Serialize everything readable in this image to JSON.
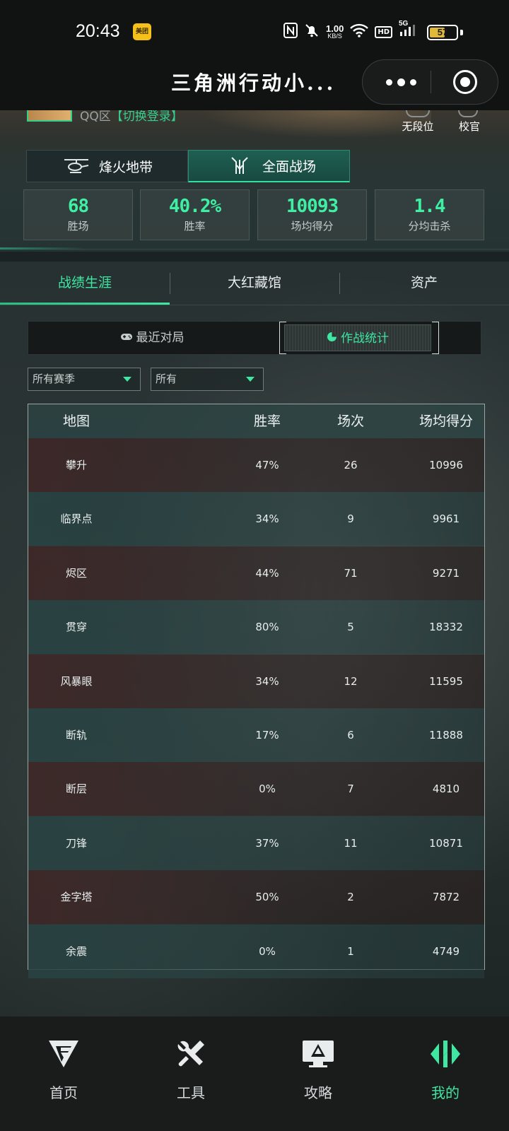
{
  "status_bar": {
    "time": "20:43",
    "meituan_badge": "美团",
    "net_speed_value": "1.00",
    "net_speed_unit": "KB/S",
    "hd_label": "HD",
    "network_label": "5G",
    "battery_level": "57",
    "battery_fraction": 0.57,
    "battery_color": "#e0b93a"
  },
  "title_bar": {
    "title": "三角洲行动小..."
  },
  "profile": {
    "server_label": "QQ区",
    "switch_login": "【切换登录】",
    "ranks": [
      {
        "label": "无段位"
      },
      {
        "label": "校官"
      }
    ]
  },
  "mode_tabs": [
    {
      "label": "烽火地带",
      "icon": "helicopter-icon",
      "active": false
    },
    {
      "label": "全面战场",
      "icon": "battlefield-emblem-icon",
      "active": true
    }
  ],
  "stats": [
    {
      "value": "68",
      "label": "胜场"
    },
    {
      "value": "40.2%",
      "label": "胜率"
    },
    {
      "value": "10093",
      "label": "场均得分"
    },
    {
      "value": "1.4",
      "label": "分均击杀"
    }
  ],
  "section_tabs": [
    {
      "label": "战绩生涯",
      "active": true
    },
    {
      "label": "大红藏馆",
      "active": false
    },
    {
      "label": "资产",
      "active": false
    }
  ],
  "sub_tabs": [
    {
      "label": "最近对局",
      "icon": "gamepad-icon",
      "active": false
    },
    {
      "label": "作战统计",
      "icon": "pie-chart-icon",
      "active": true
    }
  ],
  "filters": {
    "season": "所有赛季",
    "scope": "所有"
  },
  "map_table": {
    "headers": {
      "map": "地图",
      "win_rate": "胜率",
      "matches": "场次",
      "avg_score": "场均得分"
    },
    "rows": [
      {
        "map": "攀升",
        "win_rate": "47%",
        "matches": "26",
        "avg_score": "10996"
      },
      {
        "map": "临界点",
        "win_rate": "34%",
        "matches": "9",
        "avg_score": "9961"
      },
      {
        "map": "烬区",
        "win_rate": "44%",
        "matches": "71",
        "avg_score": "9271"
      },
      {
        "map": "贯穿",
        "win_rate": "80%",
        "matches": "5",
        "avg_score": "18332"
      },
      {
        "map": "风暴眼",
        "win_rate": "34%",
        "matches": "12",
        "avg_score": "11595"
      },
      {
        "map": "断轨",
        "win_rate": "17%",
        "matches": "6",
        "avg_score": "11888"
      },
      {
        "map": "断层",
        "win_rate": "0%",
        "matches": "7",
        "avg_score": "4810"
      },
      {
        "map": "刀锋",
        "win_rate": "37%",
        "matches": "11",
        "avg_score": "10871"
      },
      {
        "map": "金字塔",
        "win_rate": "50%",
        "matches": "2",
        "avg_score": "7872"
      },
      {
        "map": "余震",
        "win_rate": "0%",
        "matches": "1",
        "avg_score": "4749"
      }
    ]
  },
  "bottom_nav": [
    {
      "label": "首页",
      "icon": "home-logo-icon",
      "active": false
    },
    {
      "label": "工具",
      "icon": "tools-icon",
      "active": false
    },
    {
      "label": "攻略",
      "icon": "guide-monitor-icon",
      "active": false
    },
    {
      "label": "我的",
      "icon": "profile-emblem-icon",
      "active": true
    }
  ],
  "colors": {
    "accent": "#3ee7a2",
    "header_bg": "#111313",
    "row_red": "#402626",
    "row_teal": "#284242"
  }
}
